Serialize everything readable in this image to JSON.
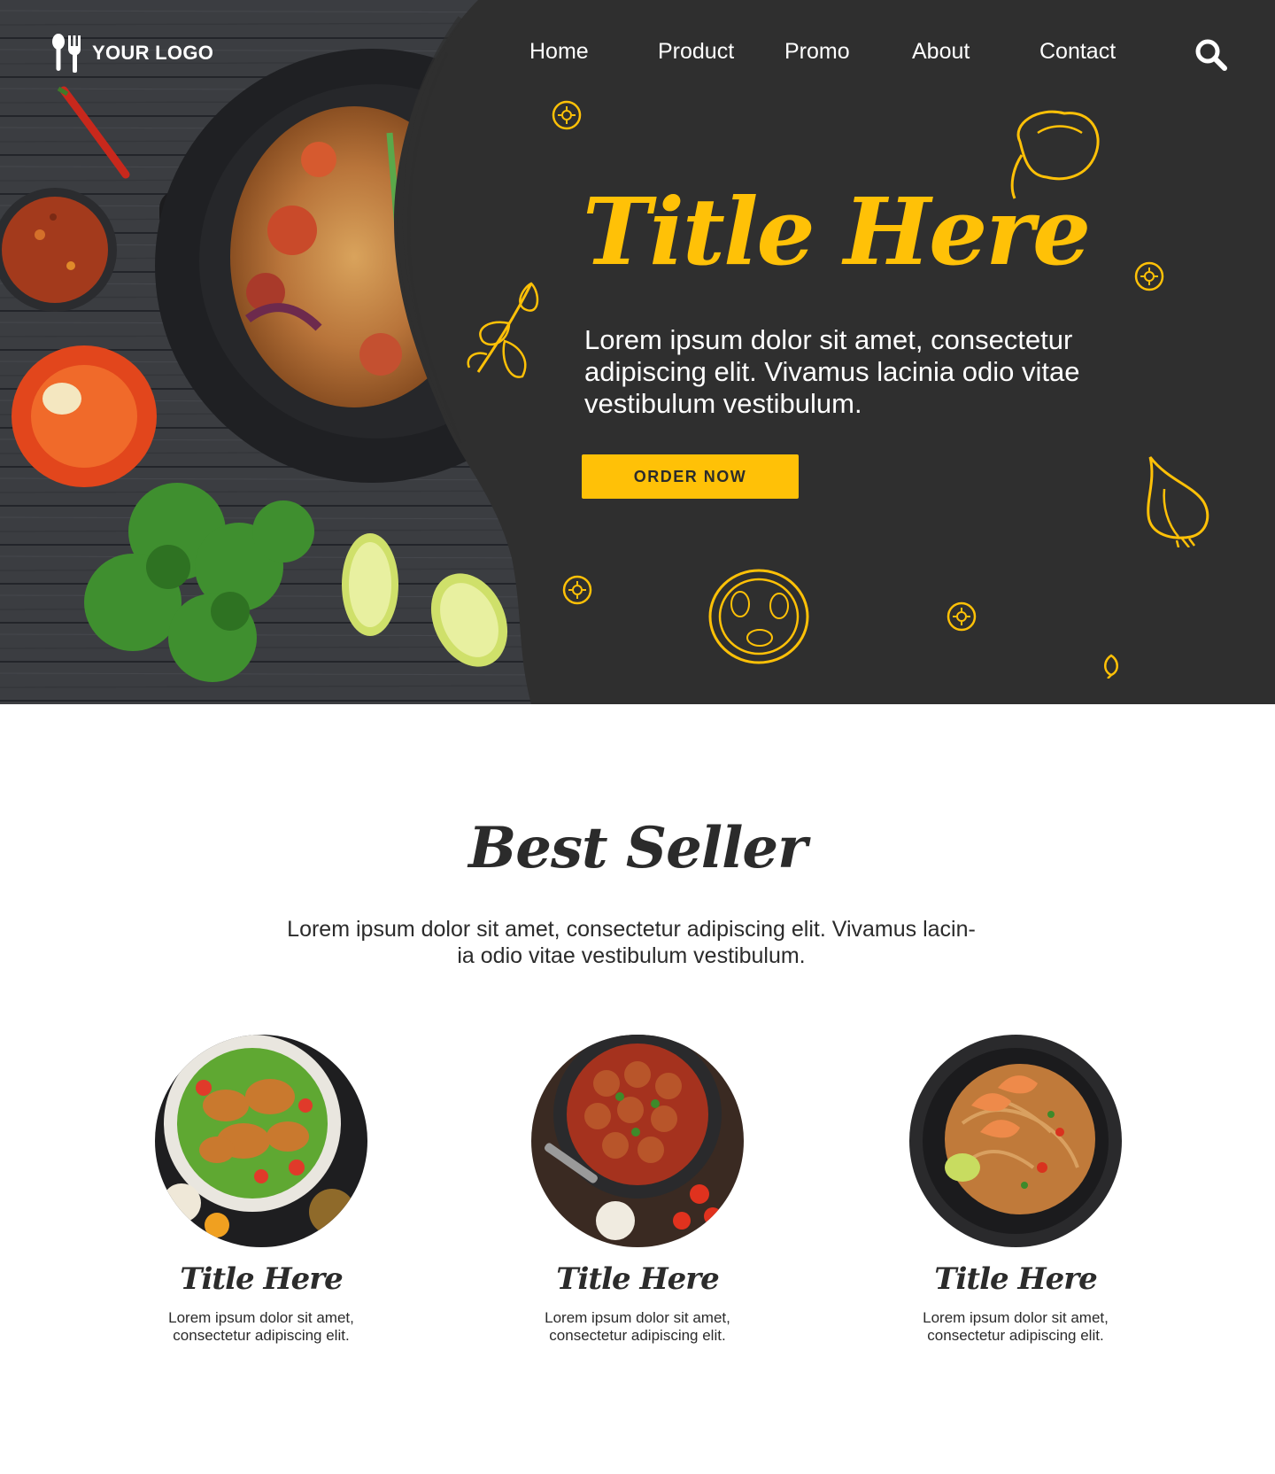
{
  "brand": {
    "logo_text": "YOUR LOGO"
  },
  "nav": {
    "items": [
      {
        "label": "Home"
      },
      {
        "label": "Product"
      },
      {
        "label": "Promo"
      },
      {
        "label": "About"
      },
      {
        "label": "Contact"
      }
    ],
    "search_icon": "search-icon"
  },
  "hero": {
    "title": "Title Here",
    "description": "Lorem ipsum dolor sit amet, consectetur adipiscing elit. Vivamus lacinia odio vitae vestibulum vestibulum.",
    "cta_label": "ORDER NOW"
  },
  "best_seller": {
    "title": "Best Seller",
    "description_line1": "Lorem ipsum dolor sit amet, consectetur adipiscing elit. Vivamus lacin-",
    "description_line2": "ia odio vitae vestibulum vestibulum.",
    "cards": [
      {
        "title": "Title Here",
        "line1": "Lorem ipsum dolor sit amet,",
        "line2": "consectetur adipiscing elit."
      },
      {
        "title": "Title Here",
        "line1": "Lorem ipsum dolor sit amet,",
        "line2": "consectetur adipiscing elit."
      },
      {
        "title": "Title Here",
        "line1": "Lorem ipsum dolor sit amet,",
        "line2": "consectetur adipiscing elit."
      }
    ]
  },
  "colors": {
    "accent": "#ffc107",
    "dark_panel": "#2f2f2f",
    "text_dark": "#2b2b2b",
    "white": "#ffffff"
  }
}
